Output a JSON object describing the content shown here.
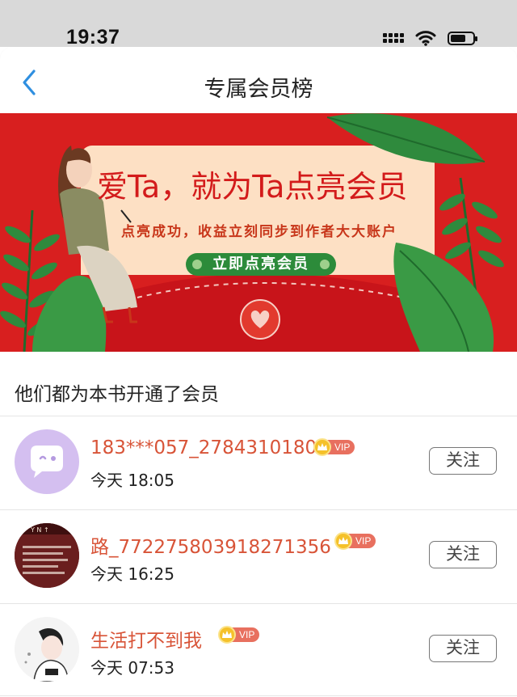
{
  "status_bar": {
    "time": "19:37"
  },
  "nav": {
    "title": "专属会员榜"
  },
  "banner": {
    "headline": "爱Ta，就为Ta点亮会员",
    "subtitle": "点亮成功，收益立刻同步到作者大大账户",
    "cta_label": "立即点亮会员",
    "colors": {
      "background": "#d81f1f",
      "card": "#fde0c4",
      "cta": "#2c8b3a"
    }
  },
  "section": {
    "title": "他们都为本书开通了会员"
  },
  "members": [
    {
      "name": "183***057_2784310180",
      "badge": "VIP",
      "time": "今天 18:05",
      "follow_label": "关注"
    },
    {
      "name": "路_772275803918271356",
      "badge": "VIP",
      "time": "今天 16:25",
      "follow_label": "关注"
    },
    {
      "name": "生活打不到我",
      "badge": "VIP",
      "time": "今天 07:53",
      "follow_label": "关注"
    }
  ],
  "colors": {
    "accent": "#d85438",
    "vip": "#e8705f",
    "back": "#2f8fe0"
  }
}
